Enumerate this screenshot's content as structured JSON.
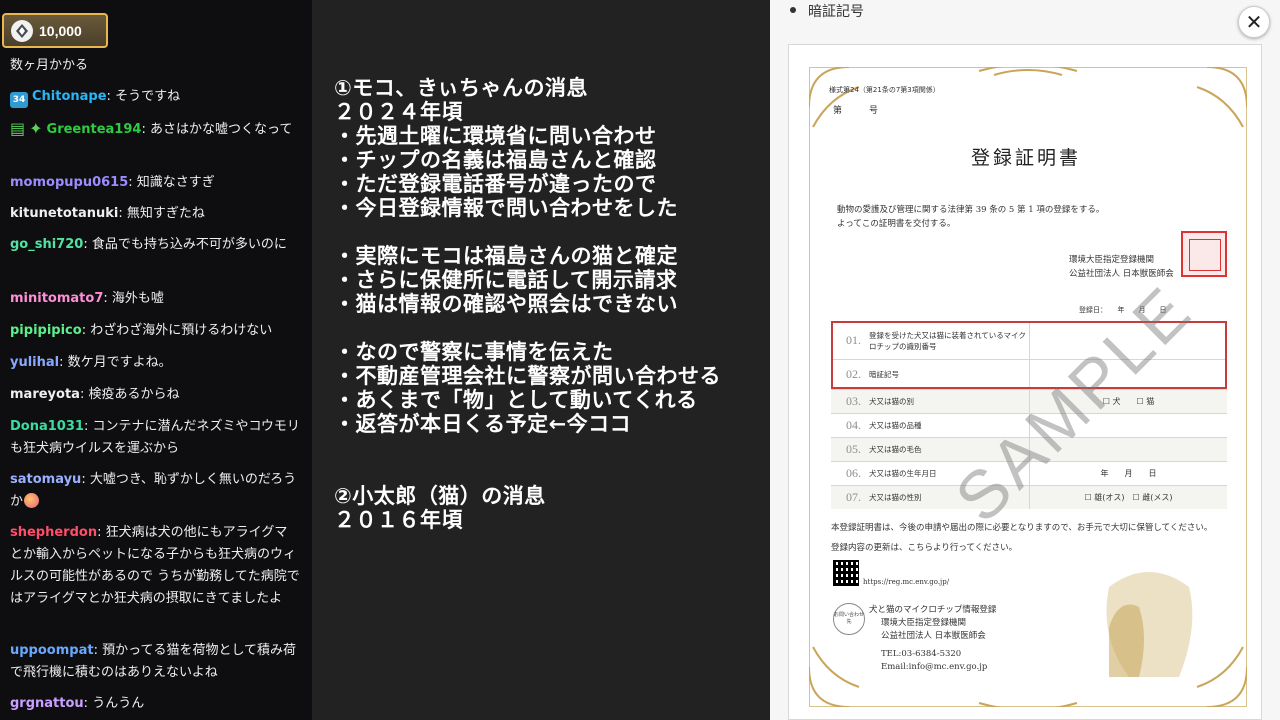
{
  "chat": {
    "points": "10,000",
    "messages": [
      {
        "user": "",
        "text": "数ヶ月かかる",
        "color": "#efeff1"
      },
      {
        "user": "Chitonape",
        "text": "そうですね",
        "color": "#29b6f6",
        "badge": "34"
      },
      {
        "user": "Greentea194",
        "text": "あさはかな嘘つくなって",
        "color": "#2ecc40",
        "badge": "subscriber"
      },
      {
        "user": "momopupu0615",
        "text": "知識なさすぎ",
        "color": "#9b8cff"
      },
      {
        "user": "kitunetotanuki",
        "text": "無知すぎたね",
        "color": "#efeff1"
      },
      {
        "user": "go_shi720",
        "text": "食品でも持ち込み不可が多いのに",
        "color": "#52e2a1"
      },
      {
        "user": "minitomato7",
        "text": "海外も嘘",
        "color": "#ff8ed6"
      },
      {
        "user": "pipipipico",
        "text": "わざわざ海外に預けるわけない",
        "color": "#5cf08a"
      },
      {
        "user": "yulihal",
        "text": "数ケ月ですよね。",
        "color": "#8aa8ff"
      },
      {
        "user": "mareyota",
        "text": "検疫あるからね",
        "color": "#efeff1"
      },
      {
        "user": "Dona1031",
        "text": "コンテナに潜んだネズミやコウモリも狂犬病ウイルスを運ぶから",
        "color": "#3bdca0"
      },
      {
        "user": "satomayu",
        "text": "大嘘つき、恥ずかしく無いのだろうか",
        "color": "#9ab0ff"
      },
      {
        "user": "shepherdon",
        "text": "狂犬病は犬の他にもアライグマとか輸入からペットになる子からも狂犬病のウィルスの可能性があるので うちが勤務してた病院ではアライグマとか狂犬病の摂取にきてましたよ",
        "color": "#ff4d6a"
      },
      {
        "user": "uppoompat",
        "text": "預かってる猫を荷物として積み荷で飛行機に積むのはありえないよね",
        "color": "#6aa8ff"
      },
      {
        "user": "grgnattou",
        "text": "うんうん",
        "color": "#c9a0ff"
      }
    ]
  },
  "notes": {
    "lines": [
      "①モコ、きぃちゃんの消息",
      "２０２４年頃",
      "・先週土曜に環境省に問い合わせ",
      "・チップの名義は福島さんと確認",
      "・ただ登録電話番号が違ったので",
      "・今日登録情報で問い合わせをした",
      "",
      "・実際にモコは福島さんの猫と確定",
      "・さらに保健所に電話して開示請求",
      "・猫は情報の確認や照会はできない",
      "",
      "・なので警察に事情を伝えた",
      "・不動産管理会社に警察が問い合わせる",
      "・あくまで「物」として動いてくれる",
      "・返答が本日くる予定←今ココ",
      "",
      "",
      "②小太郎（猫）の消息",
      "２０１６年頃"
    ]
  },
  "doc": {
    "bullet": "暗証記号",
    "close_symbol": "✕",
    "cert": {
      "form_no": "様式第24（第21条の7第3項関係）",
      "number_label": "第　　　号",
      "title": "登録証明書",
      "law_text": "動物の愛護及び管理に関する法律第 39 条の 5 第 1 項の登録をする。",
      "issue_text": "よってこの証明書を交付する。",
      "issuer1": "環境大臣指定登録機関",
      "issuer2": "公益社団法人 日本獣医師会",
      "date_line": "登録日：　　年　　月　　日",
      "rows": [
        {
          "num": "01.",
          "label": "登録を受けた犬又は猫に装着されているマイクロチップの識別番号",
          "value": ""
        },
        {
          "num": "02.",
          "label": "暗証記号",
          "value": ""
        },
        {
          "num": "03.",
          "label": "犬又は猫の別",
          "value": "☐ 犬　　☐ 猫"
        },
        {
          "num": "04.",
          "label": "犬又は猫の品種",
          "value": ""
        },
        {
          "num": "05.",
          "label": "犬又は猫の毛色",
          "value": ""
        },
        {
          "num": "06.",
          "label": "犬又は猫の生年月日",
          "value": "年　　月　　日"
        },
        {
          "num": "07.",
          "label": "犬又は猫の性別",
          "value": "☐ 雄(オス)　☐ 雌(メス)"
        }
      ],
      "note1": "本登録証明書は、今後の申請や届出の際に必要となりますので、お手元で大切に保管してください。",
      "note2": "登録内容の更新は、こちらより行ってください。",
      "url": "https://reg.mc.env.go.jp/",
      "footer1": "犬と猫のマイクロチップ情報登録",
      "footer2": "環境大臣指定登録機関",
      "footer3": "公益社団法人 日本獣医師会",
      "tel": "TEL:03-6384-5320",
      "email": "Email:info@mc.env.go.jp",
      "contact_mark": "お問い合わせ先",
      "watermark": "SAMPLE"
    }
  },
  "colors": {
    "chat_bg": "#0e0e10",
    "notes_bg": "#222222",
    "gold": "#c9a55a",
    "seal_red": "#d33333"
  }
}
